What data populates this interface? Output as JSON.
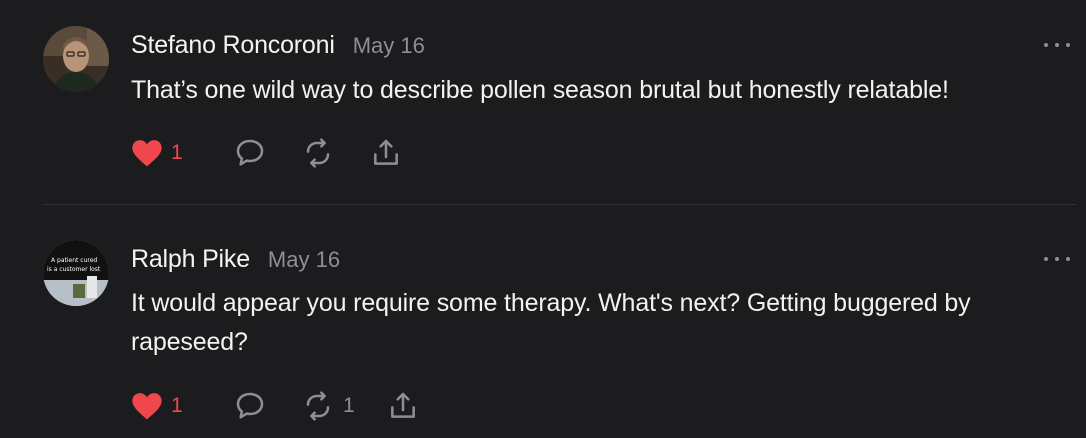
{
  "comments": [
    {
      "author": "Stefano Roncoroni",
      "date": "May 16",
      "text": "That’s one wild way to describe pollen season brutal but honestly relatable!",
      "likes": "1",
      "restacks": "",
      "liked": true,
      "avatar_icon": "person-photo-avatar"
    },
    {
      "author": "Ralph Pike",
      "date": "May 16",
      "text": "It would appear you require some therapy. What's next? Getting buggered by rapeseed?",
      "likes": "1",
      "restacks": "1",
      "liked": true,
      "avatar_icon": "sign-photo-avatar",
      "avatar_text": [
        "A patient cured",
        "is a customer lost"
      ]
    }
  ],
  "colors": {
    "background": "#1c1c1e",
    "heart": "#f0474d",
    "muted": "#8e8e93",
    "text": "#f2f2f2"
  }
}
